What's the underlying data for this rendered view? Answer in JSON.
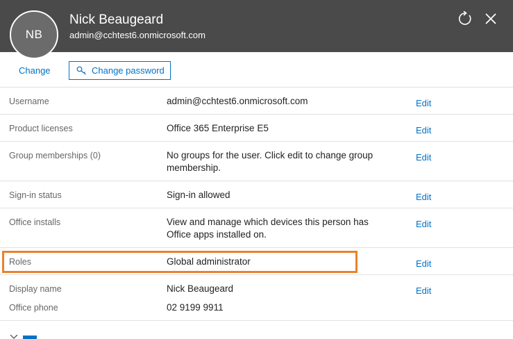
{
  "header": {
    "avatar_initials": "NB",
    "name": "Nick Beaugeard",
    "email": "admin@cchtest6.onmicrosoft.com",
    "icons": [
      "refresh-icon",
      "close-icon"
    ]
  },
  "actions": {
    "change_label": "Change",
    "change_password_label": "Change password",
    "change_password_icon": "key-icon"
  },
  "rows": [
    {
      "label": "Username",
      "value": "admin@cchtest6.onmicrosoft.com",
      "edit": "Edit"
    },
    {
      "label": "Product licenses",
      "value": "Office 365 Enterprise E5",
      "edit": "Edit"
    },
    {
      "label": "Group memberships (0)",
      "value": "No groups for the user. Click edit to change group membership.",
      "edit": "Edit"
    },
    {
      "label": "Sign-in status",
      "value": "Sign-in allowed",
      "edit": "Edit"
    },
    {
      "label": "Office installs",
      "value": "View and manage which devices this person has Office apps installed on.",
      "edit": "Edit"
    },
    {
      "label": "Roles",
      "value": "Global administrator",
      "edit": "Edit"
    },
    {
      "label": "Display name",
      "value": "Nick Beaugeard",
      "edit": "Edit"
    },
    {
      "label": "Office phone",
      "value": "02 9199 9911"
    }
  ],
  "colors": {
    "header_bg": "#4a4a4a",
    "accent": "#0072c6",
    "highlight": "#e8822c"
  }
}
